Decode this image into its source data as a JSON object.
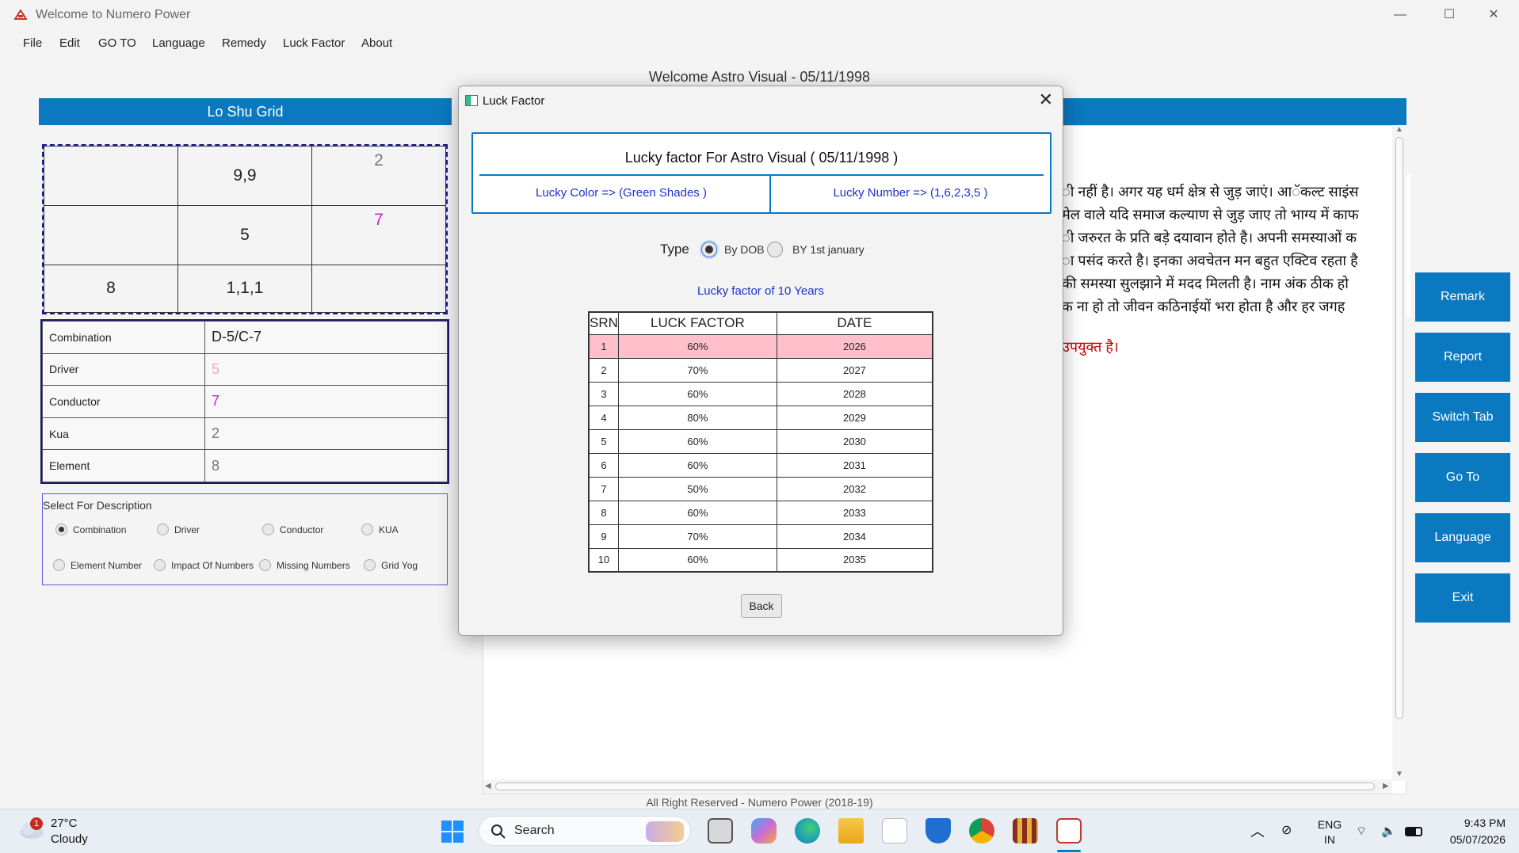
{
  "window": {
    "title": "Welcome to Numero Power",
    "minimize": "—",
    "maximize": "☐",
    "close": "✕"
  },
  "menu": [
    "File",
    "Edit",
    "GO TO",
    "Language",
    "Remedy",
    "Luck Factor",
    "About"
  ],
  "welcome": "Welcome Astro Visual - 05/11/1998",
  "loshu": {
    "header": "Lo Shu Grid",
    "cells": [
      "",
      "9,9",
      "2",
      "",
      "5",
      "7",
      "8",
      "1,1,1",
      ""
    ]
  },
  "info": {
    "rows": [
      {
        "label": "Combination",
        "value": "D-5/C-7",
        "color": "#222222"
      },
      {
        "label": "Driver",
        "value": "5",
        "color": "#f4a7b9"
      },
      {
        "label": "Conductor",
        "value": "7",
        "color": "#d020d0"
      },
      {
        "label": "Kua",
        "value": "2",
        "color": "#777777"
      },
      {
        "label": "Element",
        "value": "8",
        "color": "#777777"
      }
    ]
  },
  "description": {
    "title": "Select For Description",
    "options": [
      "Combination",
      "Driver",
      "Conductor",
      "KUA",
      "Element Number",
      "Impact Of Numbers",
      "Missing Numbers",
      "Grid Yog"
    ],
    "selected": "Combination"
  },
  "hindi_lines": [
    "ी नहीं है। अगर यह धर्म क्षेत्र से जुड़ जाएं। आॅकल्ट साइंस",
    "मेल वाले यदि समाज कल्याण से जुड़ जाए तो भाग्य में काफ",
    "ी जरुरत के प्रति बड़े दयावान होते है। अपनी समस्याओं क",
    "ा पसंद करते है। इनका अवचेतन मन बहुत एक्टिव रहता है",
    "की समस्या सुलझाने में मदद मिलती है। नाम अंक ठीक हो",
    "क ना हो तो जीवन कठिनाईयों भरा होता है और हर जगह"
  ],
  "hindi_red": "उपयुक्त है।",
  "side_buttons": [
    "Remark",
    "Report",
    "Switch Tab",
    "Go To",
    "Language",
    "Exit"
  ],
  "footer": "All Right Reserved - Numero Power (2018-19)",
  "dialog": {
    "title": "Luck Factor",
    "lucky_title": "Lucky factor For Astro Visual ( 05/11/1998 )",
    "lucky_color": "Lucky Color => (Green Shades )",
    "lucky_number": "Lucky Number => (1,6,2,3,5 )",
    "type_label": "Type",
    "type_options": [
      "By DOB",
      "BY 1st january"
    ],
    "type_selected": "By DOB",
    "ten_years_title": "Lucky factor of 10 Years",
    "table": {
      "headers": [
        "SRN",
        "LUCK FACTOR",
        "DATE"
      ],
      "rows": [
        [
          "1",
          "60%",
          "2026"
        ],
        [
          "2",
          "70%",
          "2027"
        ],
        [
          "3",
          "60%",
          "2028"
        ],
        [
          "4",
          "80%",
          "2029"
        ],
        [
          "5",
          "60%",
          "2030"
        ],
        [
          "6",
          "60%",
          "2031"
        ],
        [
          "7",
          "50%",
          "2032"
        ],
        [
          "8",
          "60%",
          "2033"
        ],
        [
          "9",
          "70%",
          "2034"
        ],
        [
          "10",
          "60%",
          "2035"
        ]
      ],
      "highlight_row": 0
    },
    "back": "Back"
  },
  "taskbar": {
    "weather_badge": "1",
    "temp": "27°C",
    "condition": "Cloudy",
    "search": "Search",
    "lang_top": "ENG",
    "lang_bottom": "IN",
    "time": "9:43 PM",
    "date": "05/07/2026"
  }
}
